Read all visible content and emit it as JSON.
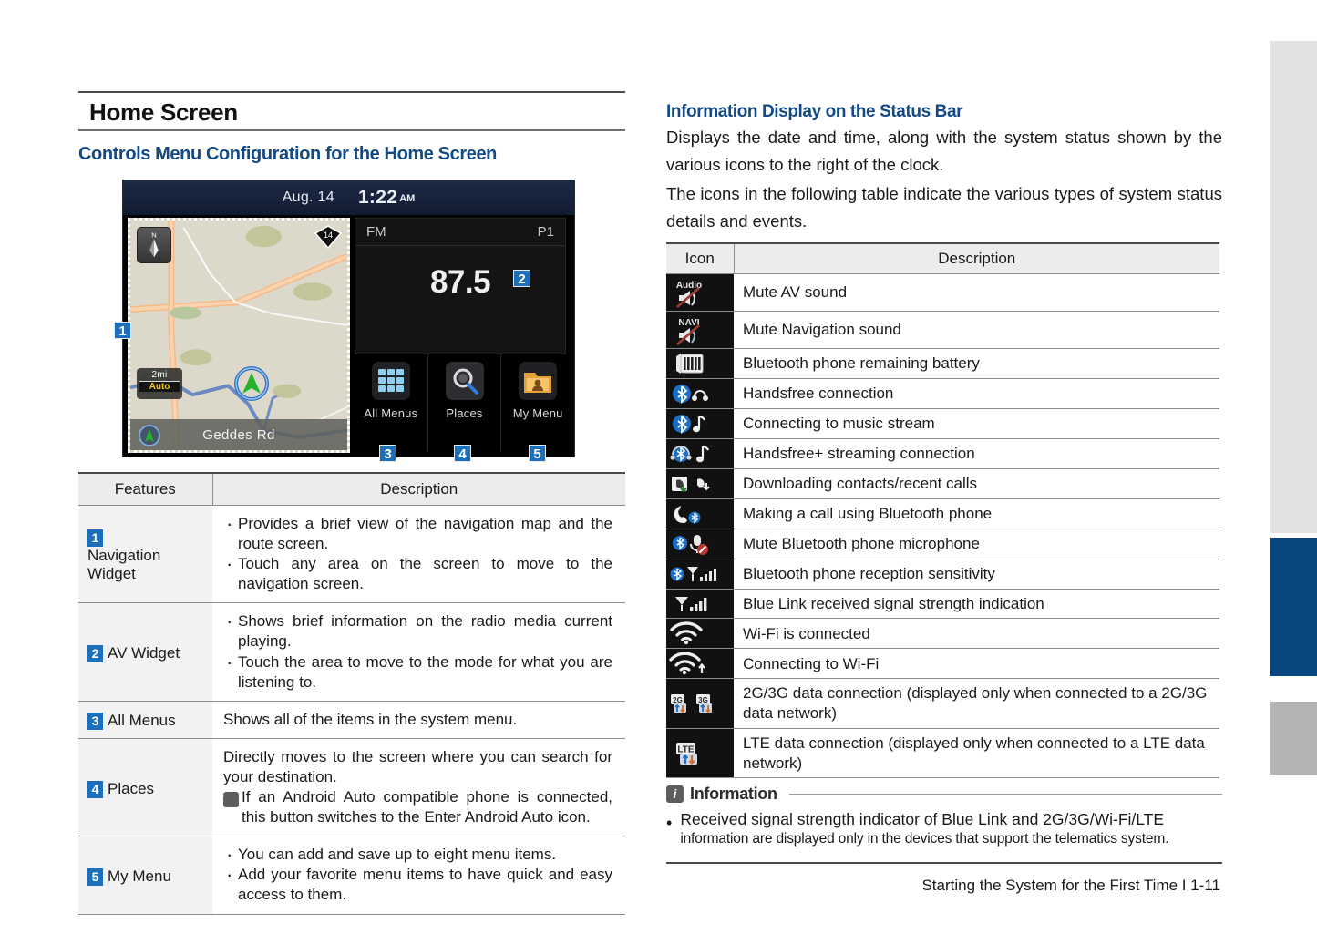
{
  "left": {
    "heading": "Home Screen",
    "subheading": "Controls Menu Configuration for the Home Screen",
    "device": {
      "status_date": "Aug. 14",
      "status_time": "1:22",
      "status_ampm": "AM",
      "map_road": "Geddes Rd",
      "map_scale": "2mi",
      "map_scale_mode": "Auto",
      "map_compass": "N",
      "map_shield": "14",
      "av_source": "FM",
      "av_preset": "P1",
      "av_frequency": "87.5",
      "shortcuts": [
        {
          "label": "All Menus",
          "icon": "grid-icon",
          "callout": "3"
        },
        {
          "label": "Places",
          "icon": "magnifier-icon",
          "callout": "4"
        },
        {
          "label": "My Menu",
          "icon": "folder-person-icon",
          "callout": "5"
        }
      ],
      "callout_nav": "1",
      "callout_av": "2"
    },
    "table": {
      "headers": [
        "Features",
        "Description"
      ],
      "rows": [
        {
          "num": "1",
          "feature": "Navigation Widget",
          "bullets": [
            "Provides a brief view of the navigation map and the route screen.",
            "Touch any area on the screen to move to the navigation screen."
          ]
        },
        {
          "num": "2",
          "feature": "AV Widget",
          "bullets": [
            "Shows brief information on the radio media current playing.",
            "Touch the area to move to the mode for what you are listening to."
          ]
        },
        {
          "num": "3",
          "feature": "All Menus",
          "plain": "Shows all of the items in the system menu."
        },
        {
          "num": "4",
          "feature": "Places",
          "plain": "Directly moves to the screen where you can search for your destination.",
          "note": "If an Android Auto compatible phone is connected, this button switches to the Enter Android Auto icon."
        },
        {
          "num": "5",
          "feature": "My Menu",
          "bullets": [
            "You can add and save up to eight menu items.",
            "Add your favorite menu items to have quick and easy access to them."
          ]
        }
      ]
    }
  },
  "right": {
    "heading": "Information Display on the Status Bar",
    "paragraph1": "Displays the date and time, along with the system status shown by the various icons to the right of the clock.",
    "paragraph2": "The icons in the following table indicate the various types of system status details and events.",
    "table": {
      "headers": [
        "Icon",
        "Description"
      ],
      "rows": [
        {
          "icon": "mute-av-sound-icon",
          "label": "Audio",
          "description": "Mute AV sound"
        },
        {
          "icon": "mute-navigation-sound-icon",
          "label": "NAVI",
          "description": "Mute Navigation sound"
        },
        {
          "icon": "battery-icon",
          "description": "Bluetooth phone remaining battery"
        },
        {
          "icon": "bluetooth-headset-icon",
          "description": "Handsfree connection"
        },
        {
          "icon": "bluetooth-music-icon",
          "description": "Connecting to music stream"
        },
        {
          "icon": "bluetooth-headset-music-icon",
          "description": "Handsfree+ streaming connection"
        },
        {
          "icon": "download-contacts-icon",
          "description": "Downloading contacts/recent calls"
        },
        {
          "icon": "phone-call-icon",
          "description": "Making a call using Bluetooth phone"
        },
        {
          "icon": "mute-microphone-icon",
          "description": "Mute Bluetooth phone microphone"
        },
        {
          "icon": "bluetooth-signal-icon",
          "description": "Bluetooth phone reception sensitivity"
        },
        {
          "icon": "signal-bars-icon",
          "description": "Blue Link received signal strength indication"
        },
        {
          "icon": "wifi-connected-icon",
          "description": "Wi-Fi is connected"
        },
        {
          "icon": "wifi-connecting-icon",
          "description": "Connecting to Wi-Fi"
        },
        {
          "icon": "data-2g-3g-icon",
          "label": "2G 3G",
          "description": "2G/3G data connection (displayed only when connected to a 2G/3G data network)"
        },
        {
          "icon": "data-lte-icon",
          "label": "LTE",
          "description": "LTE data connection (displayed only when connected to a LTE data network)"
        }
      ]
    },
    "info": {
      "title": "Information",
      "line1": "Received signal strength indicator of Blue Link and 2G/3G/Wi-Fi/LTE",
      "line2": "information are displayed only in the devices that support the telematics system."
    },
    "footer": "Starting the System for the First Time I 1-11"
  },
  "colors": {
    "heading_blue": "#124a86",
    "badge_blue": "#1b6fbb",
    "tab_blue": "#07467f",
    "tab_gray": "#b4b4b4",
    "tab_light": "#e2e2e2"
  }
}
